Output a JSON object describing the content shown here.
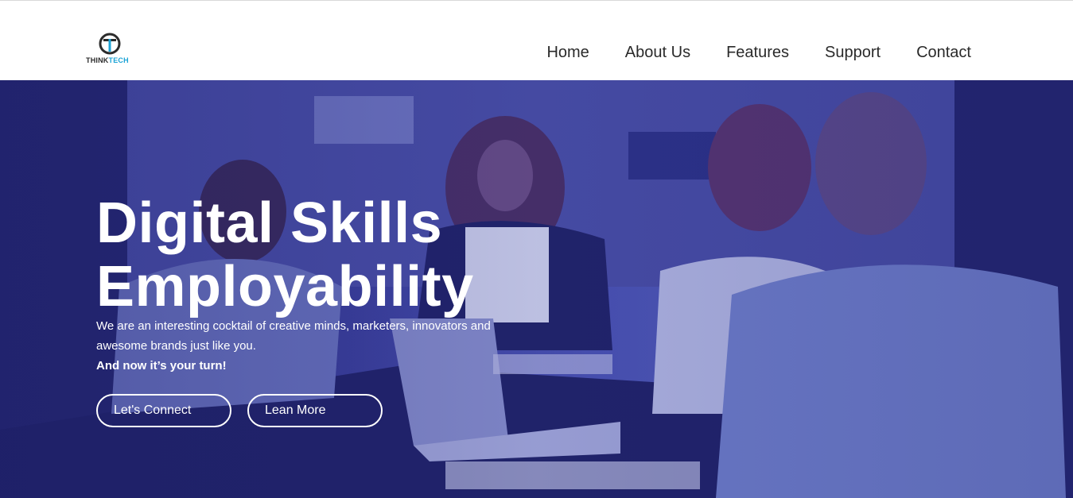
{
  "brand": {
    "logo_text_main": "THINK",
    "logo_text_accent": "TECH",
    "accent_color": "#1ba3d6"
  },
  "nav": {
    "items": [
      {
        "label": "Home"
      },
      {
        "label": "About Us"
      },
      {
        "label": "Features"
      },
      {
        "label": "Support"
      },
      {
        "label": "Contact"
      }
    ]
  },
  "hero": {
    "title_line1": "Digital Skills",
    "title_line2": "Employability",
    "subtitle": "We are an interesting cocktail of creative minds, marketers, innovators and awesome brands just like you.",
    "subtitle_bold": "And now it’s your turn!",
    "primary_button": "Let's Connect",
    "secondary_button": "Lean More",
    "overlay_color": "#3a3f9a"
  }
}
